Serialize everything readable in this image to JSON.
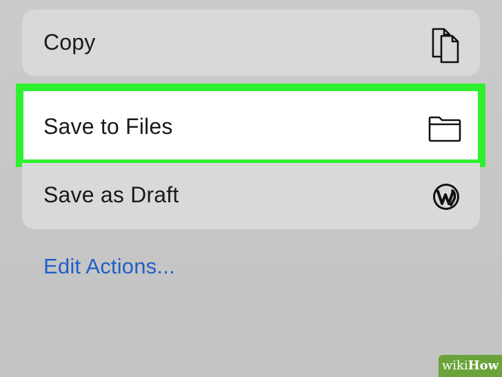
{
  "menu": {
    "copy_label": "Copy",
    "save_files_label": "Save to Files",
    "save_draft_label": "Save as Draft"
  },
  "edit_actions_label": "Edit Actions...",
  "icons": {
    "copy": "copy-icon",
    "folder": "folder-icon",
    "wordpress": "wordpress-icon"
  },
  "colors": {
    "highlight": "#2ff02f",
    "link": "#1f5fc8",
    "watermark": "#6aa33a"
  },
  "watermark": {
    "wiki": "wiki",
    "how": "How"
  }
}
